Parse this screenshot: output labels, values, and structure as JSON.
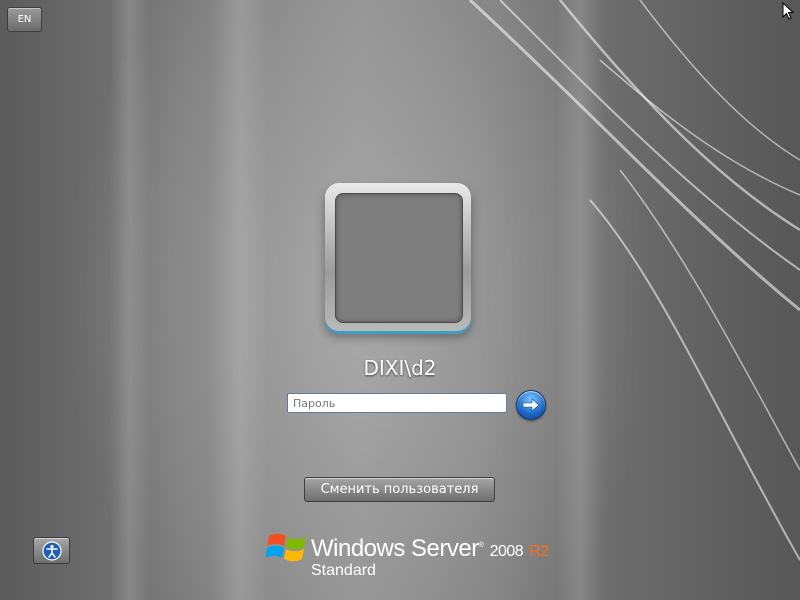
{
  "language": {
    "code": "EN"
  },
  "user": {
    "name": "DIXI\\d2"
  },
  "password": {
    "placeholder": "Пароль",
    "value": ""
  },
  "buttons": {
    "switch_user_label": "Сменить пользователя"
  },
  "branding": {
    "name": "Windows Server",
    "version": "2008",
    "release": "R2",
    "edition": "Standard",
    "accent_color": "#ff6a1a"
  },
  "icons": {
    "submit": "arrow-right-icon",
    "accessibility": "ease-of-access-icon",
    "logo": "windows-flag-icon",
    "cursor": "mouse-pointer-icon"
  }
}
